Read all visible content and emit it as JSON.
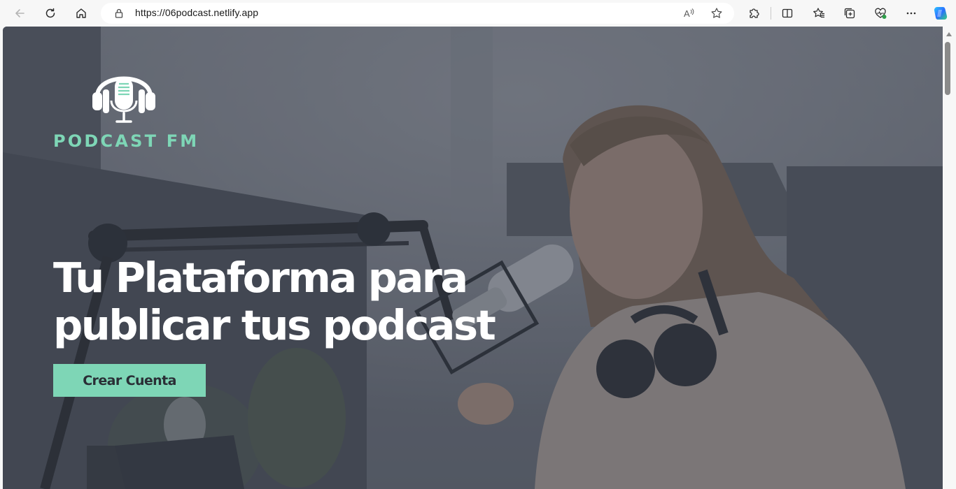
{
  "browser": {
    "url": "https://06podcast.netlify.app",
    "buttons": {
      "back": "back-arrow-icon",
      "refresh": "refresh-icon",
      "home": "home-icon",
      "read_aloud": "read-aloud-icon",
      "favorite": "star-icon",
      "extensions": "puzzle-icon",
      "split_screen": "split-screen-icon",
      "favorites": "favorites-icon",
      "collections": "collections-icon",
      "browser_essentials": "heart-pulse-icon",
      "more": "more-dots-icon",
      "copilot": "copilot-icon"
    }
  },
  "hero": {
    "logo_text": "PODCAST FM",
    "headline_line1": "Tu Plataforma para",
    "headline_line2": "publicar tus podcast",
    "cta_label": "Crear Cuenta"
  },
  "colors": {
    "accent": "#7ed6b6",
    "overlay": "#3a404c",
    "headline": "#ffffff",
    "cta_text": "#2a2f36"
  }
}
